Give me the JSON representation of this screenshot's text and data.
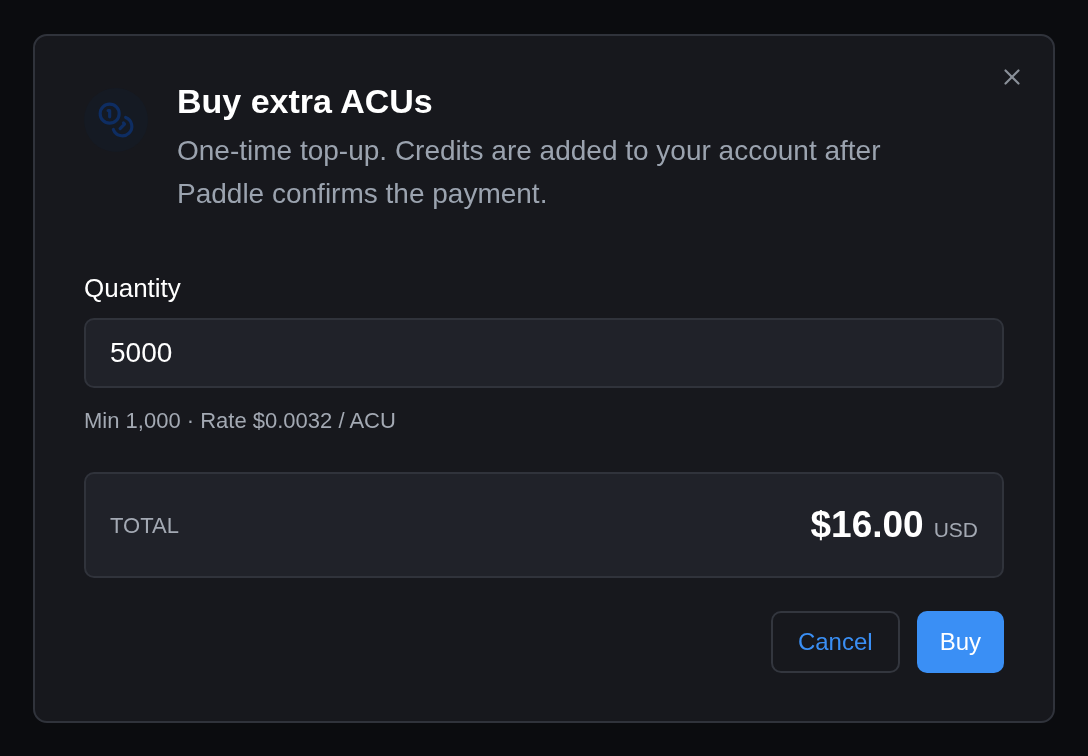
{
  "dialog": {
    "title": "Buy extra ACUs",
    "description": "One-time top-up. Credits are added to your account after Paddle confirms the payment.",
    "quantity": {
      "label": "Quantity",
      "value": "5000",
      "hint": "Min 1,000 · Rate $0.0032 / ACU"
    },
    "total": {
      "label": "TOTAL",
      "amount": "$16.00",
      "currency": "USD"
    },
    "buttons": [
      {
        "label": "Cancel",
        "kind": "secondary"
      },
      {
        "label": "Buy",
        "kind": "primary"
      }
    ]
  }
}
